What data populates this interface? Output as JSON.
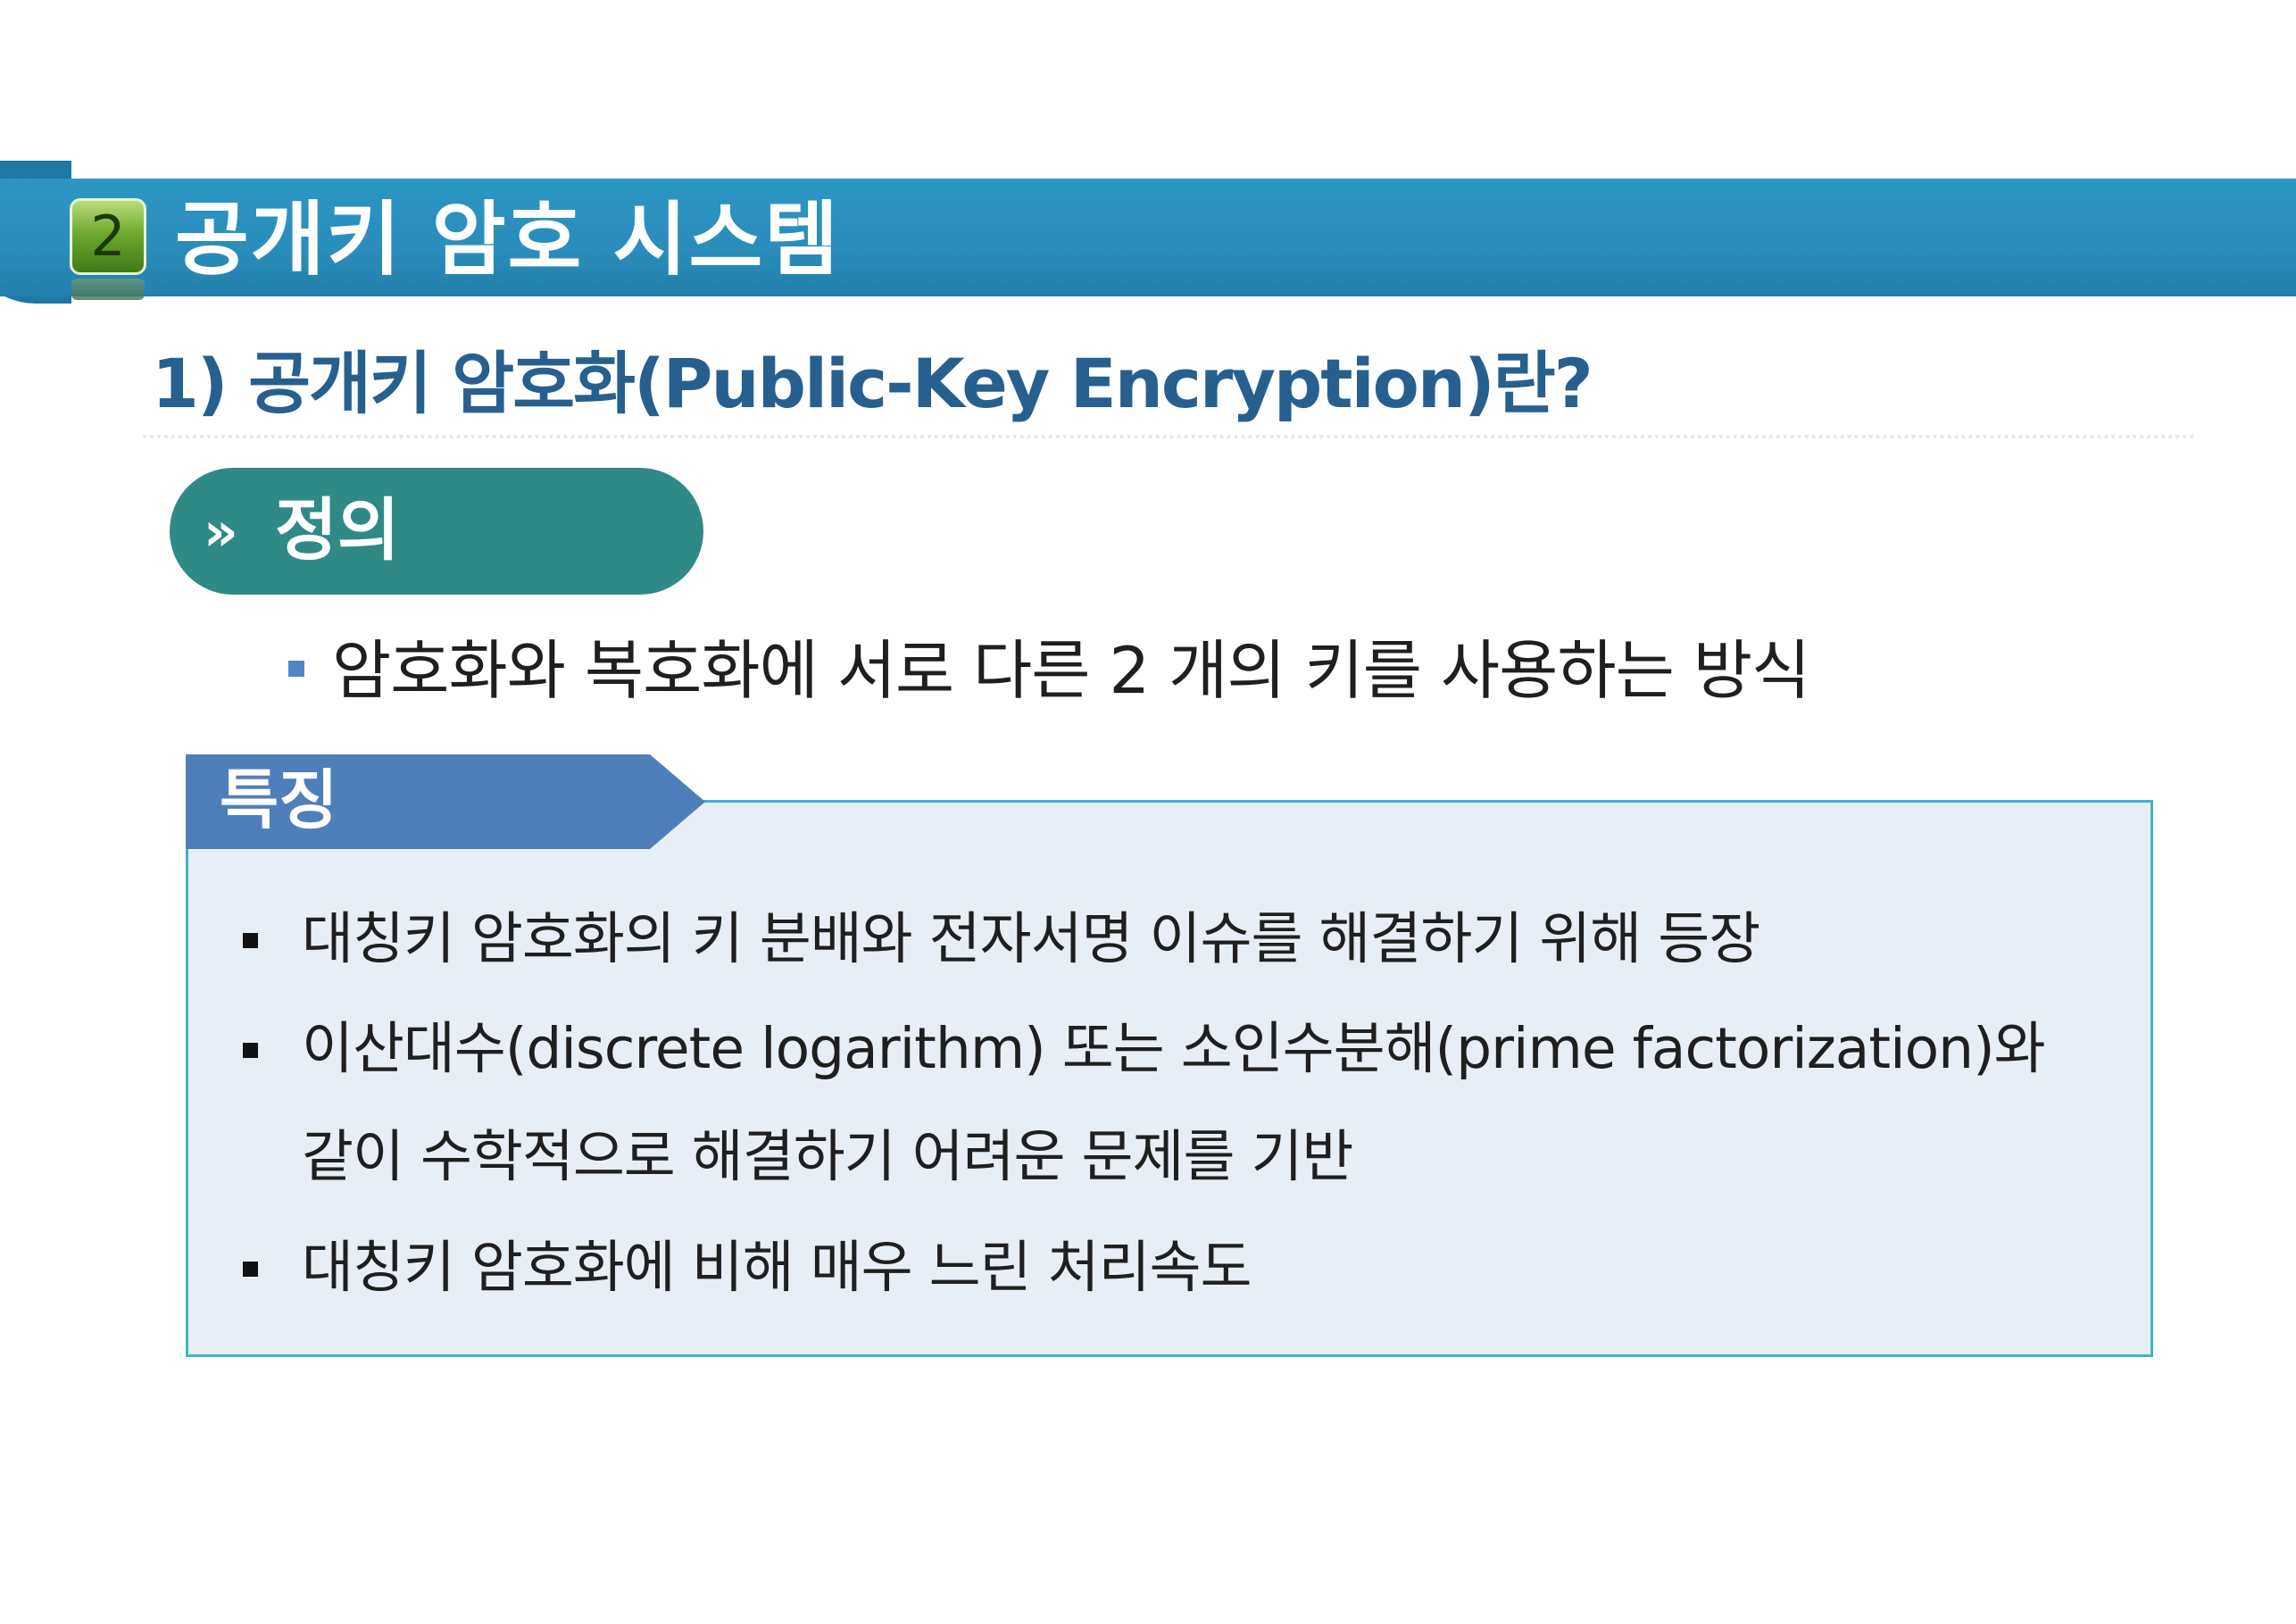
{
  "header": {
    "section_number": "2",
    "title": "공개키 암호 시스템"
  },
  "subtitle": "1) 공개키 암호화(Public-Key Encryption)란?",
  "definition": {
    "chevrons": "»",
    "label": "정의",
    "text": "암호화와 복호화에 서로 다른 2 개의 키를 사용하는 방식"
  },
  "features": {
    "label": "특징",
    "items": [
      "대칭키 암호화의 키 분배와 전자서명 이슈를 해결하기 위해 등장",
      "이산대수(discrete logarithm) 또는 소인수분해(prime factorization)와",
      "같이 수학적으로 해결하기 어려운 문제를 기반",
      "대칭키 암호화에 비해 매우 느린 처리속도"
    ]
  },
  "colors": {
    "banner": "#2a8dbb",
    "badge": "#6faa2f",
    "subtitle": "#27608f",
    "definition_pill": "#2f8a86",
    "feature_tab": "#4f7fba",
    "feature_box_bg": "#e8eef5",
    "feature_box_border": "#3fb4c8"
  }
}
